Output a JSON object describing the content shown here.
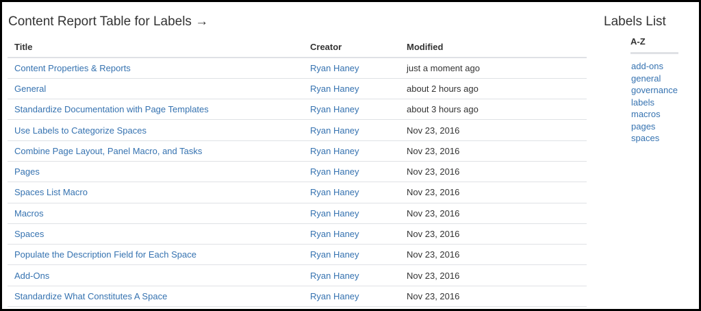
{
  "report": {
    "title": "Content Report Table for Labels →",
    "columns": [
      "Title",
      "Creator",
      "Modified"
    ],
    "rows": [
      {
        "title": "Content Properties & Reports",
        "creator": "Ryan Haney",
        "modified": "just a moment ago"
      },
      {
        "title": "General",
        "creator": "Ryan Haney",
        "modified": "about 2 hours ago"
      },
      {
        "title": "Standardize Documentation with Page Templates",
        "creator": "Ryan Haney",
        "modified": "about 3 hours ago"
      },
      {
        "title": "Use Labels to Categorize Spaces",
        "creator": "Ryan Haney",
        "modified": "Nov 23, 2016"
      },
      {
        "title": "Combine Page Layout, Panel Macro, and Tasks",
        "creator": "Ryan Haney",
        "modified": "Nov 23, 2016"
      },
      {
        "title": "Pages",
        "creator": "Ryan Haney",
        "modified": "Nov 23, 2016"
      },
      {
        "title": "Spaces List Macro",
        "creator": "Ryan Haney",
        "modified": "Nov 23, 2016"
      },
      {
        "title": "Macros",
        "creator": "Ryan Haney",
        "modified": "Nov 23, 2016"
      },
      {
        "title": "Spaces",
        "creator": "Ryan Haney",
        "modified": "Nov 23, 2016"
      },
      {
        "title": "Populate the Description Field for Each Space",
        "creator": "Ryan Haney",
        "modified": "Nov 23, 2016"
      },
      {
        "title": "Add-Ons",
        "creator": "Ryan Haney",
        "modified": "Nov 23, 2016"
      },
      {
        "title": "Standardize What Constitutes A Space",
        "creator": "Ryan Haney",
        "modified": "Nov 23, 2016"
      }
    ]
  },
  "labels_list": {
    "title": "Labels List",
    "sort_label": "A-Z",
    "items": [
      "add-ons",
      "general",
      "governance",
      "labels",
      "macros",
      "pages",
      "spaces"
    ]
  },
  "colors": {
    "link": "#3572b0",
    "text": "#333333",
    "divider": "#dfe1e5",
    "frame_border": "#000000"
  }
}
